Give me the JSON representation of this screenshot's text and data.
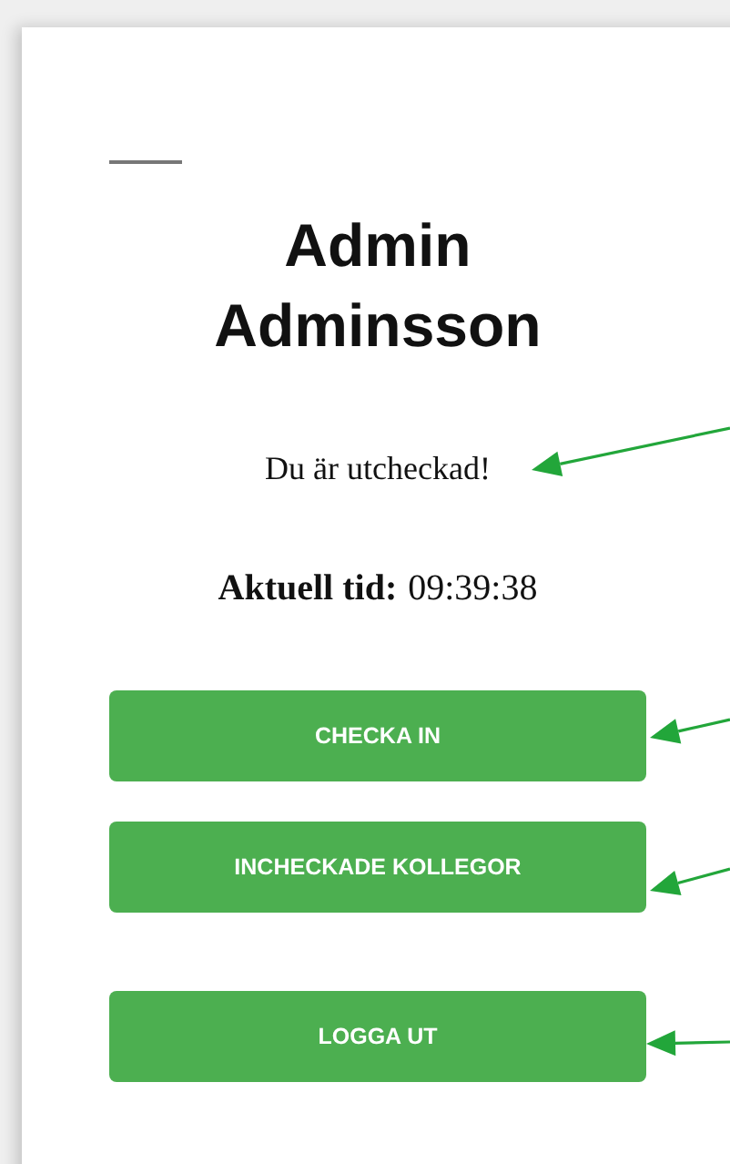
{
  "user": {
    "name": "Admin Adminsson"
  },
  "status": {
    "text": "Du är utcheckad!",
    "annotated": true
  },
  "clock": {
    "label": "Aktuell tid:",
    "value": "09:39:38"
  },
  "buttons": [
    {
      "label": "CHECKA IN",
      "annotated": true,
      "kind": "primary"
    },
    {
      "label": "INCHECKADE KOLLEGOR",
      "annotated": true,
      "kind": "primary"
    },
    {
      "label": "LOGGA UT",
      "annotated": true,
      "kind": "separated"
    }
  ]
}
